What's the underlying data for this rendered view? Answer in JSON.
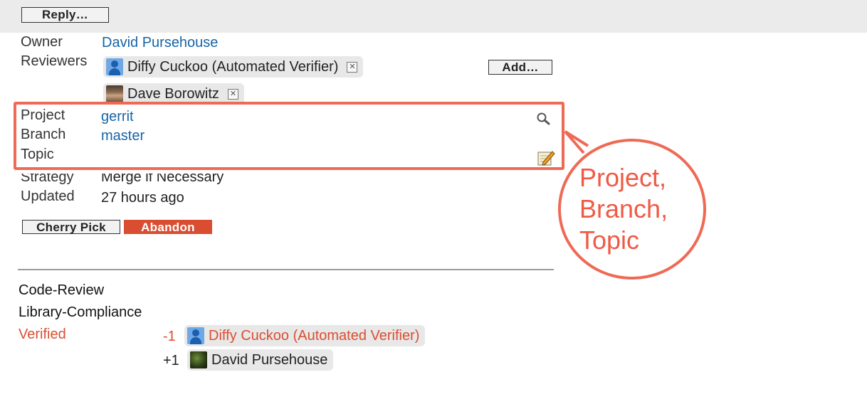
{
  "toolbar": {
    "reply_label": "Reply…"
  },
  "info": {
    "owner_label": "Owner",
    "owner_value": "David Pursehouse",
    "reviewers_label": "Reviewers",
    "reviewers": [
      {
        "name": "Diffy Cuckoo (Automated Verifier)",
        "avatar": "generic-user-icon"
      },
      {
        "name": "Dave Borowitz",
        "avatar": "photo"
      }
    ],
    "add_label": "Add…",
    "project_label": "Project",
    "project_value": "gerrit",
    "branch_label": "Branch",
    "branch_value": "master",
    "topic_label": "Topic",
    "topic_value": "",
    "strategy_label": "Strategy",
    "strategy_value": "Merge if Necessary",
    "updated_label": "Updated",
    "updated_value": "27 hours ago"
  },
  "actions": {
    "cherry_pick_label": "Cherry Pick",
    "abandon_label": "Abandon"
  },
  "callout": {
    "line1": "Project,",
    "line2": "Branch,",
    "line3": "Topic",
    "color": "#ef5a45"
  },
  "labels": {
    "code_review": "Code-Review",
    "library_compliance": "Library-Compliance",
    "verified": "Verified",
    "votes": [
      {
        "score": "-1",
        "name": "Diffy Cuckoo (Automated Verifier)",
        "color": "#d94e31"
      },
      {
        "score": "+1",
        "name": "David Pursehouse",
        "color": "#222222"
      }
    ]
  },
  "colors": {
    "link": "#1664a8",
    "abandon": "#d94e31",
    "highlight": "#ef6a55"
  }
}
